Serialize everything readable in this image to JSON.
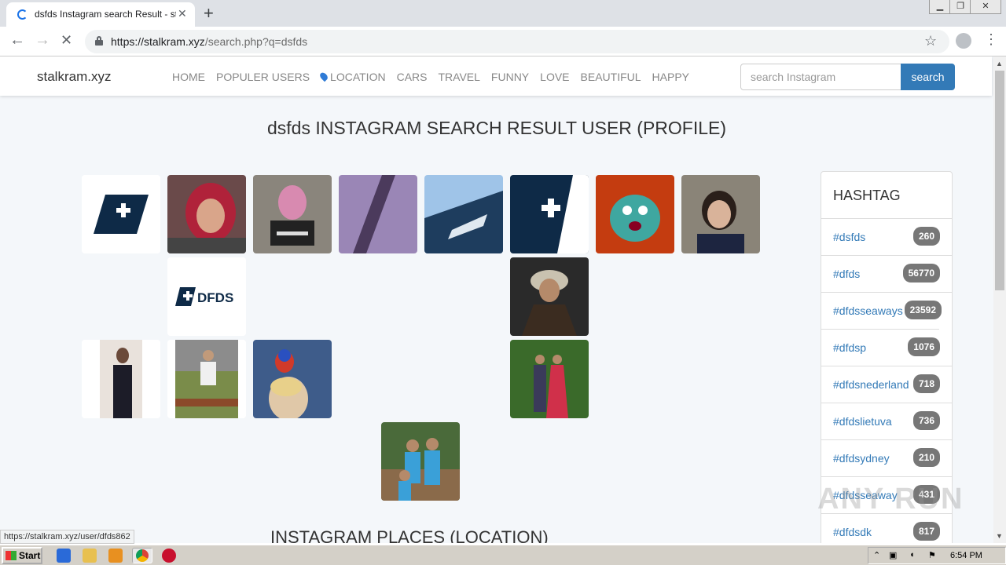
{
  "browser": {
    "tab_title": "dsfds Instagram search Result - stalkram.xyz",
    "close_glyph": "✕",
    "new_tab_glyph": "+",
    "url_domain": "https://stalkram.xyz",
    "url_path": "/search.php?q=dsfds",
    "status_url": "https://stalkram.xyz/user/dfds862"
  },
  "site": {
    "brand": "stalkram.xyz",
    "nav": [
      "HOME",
      "POPULER USERS",
      "LOCATION",
      "CARS",
      "TRAVEL",
      "FUNNY",
      "LOVE",
      "BEAUTIFUL",
      "HAPPY"
    ],
    "search_placeholder": "search Instagram",
    "search_button": "search",
    "title": "dsfds INSTAGRAM SEARCH RESULT USER (PROFILE)",
    "places_heading": "INSTAGRAM PLACES (LOCATION)"
  },
  "profiles": [
    {
      "kind": "dfds-logo"
    },
    {
      "kind": "photo-hijab"
    },
    {
      "kind": "photo-sign"
    },
    {
      "kind": "photo-lavender"
    },
    {
      "kind": "photo-ship"
    },
    {
      "kind": "dfds-logo-dark"
    },
    {
      "kind": "photo-monster"
    },
    {
      "kind": "photo-woman"
    },
    {
      "kind": "dfds-wordmark",
      "text": "DFDS"
    },
    {
      "kind": "photo-elder"
    },
    {
      "kind": "photo-stripes"
    },
    {
      "kind": "photo-man-bench"
    },
    {
      "kind": "photo-parrot"
    },
    {
      "kind": "photo-couple"
    },
    {
      "kind": "photo-family"
    }
  ],
  "hashtags": {
    "heading": "HASHTAG",
    "items": [
      {
        "tag": "#dsfds",
        "count": "260"
      },
      {
        "tag": "#dfds",
        "count": "56770"
      },
      {
        "tag": "#dfdsseaways",
        "count": "23592"
      },
      {
        "tag": "#dfdsp",
        "count": "1076"
      },
      {
        "tag": "#dfdsnederland",
        "count": "718"
      },
      {
        "tag": "#dfdslietuva",
        "count": "736"
      },
      {
        "tag": "#dfdsydney",
        "count": "210"
      },
      {
        "tag": "#dfdsseaway",
        "count": "431"
      },
      {
        "tag": "#dfdsdk",
        "count": "817"
      }
    ]
  },
  "taskbar": {
    "start": "Start",
    "clock": "6:54 PM"
  },
  "watermark": "ANY RUN"
}
